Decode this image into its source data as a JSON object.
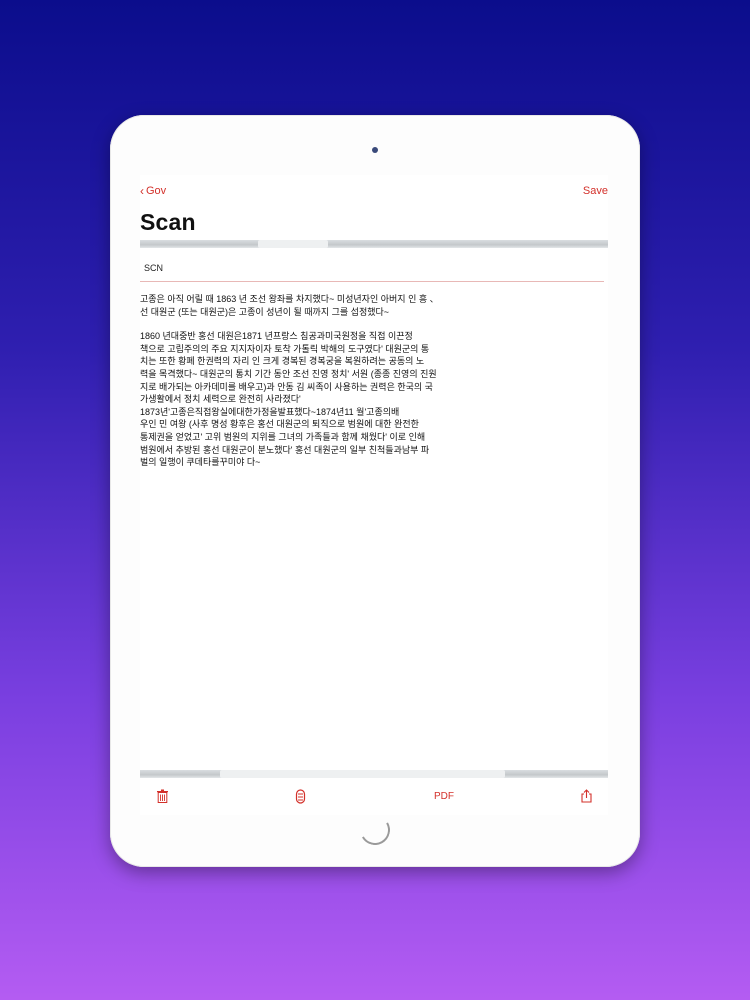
{
  "nav": {
    "back_label": "Gov",
    "save_label": "Save"
  },
  "title": "Scan",
  "field": {
    "value": "SCN"
  },
  "document": {
    "paragraphs": [
      "고종은 아직 어릴 때 1863 년 조선 왕좌를 차지했다~ 미성년자인 아버지 인 흥 、\n선 대원군 (또는 대원군)은 고종이 성년이 될 때까지 그를 섭정했다~",
      "1860 년대중반 홍선 대원은1871 년프랑스 침공과미국원정을 직접 이끈정\n책으로 고립주의의 주요 지지자이자 토착 가톨릭 박해의 도구였다' 대원군의 통\n치는 또한 황폐 한권력의 자리 인 크게 경복된 경복궁을 복원하려는 공동의 노\n력을 목격했다~ 대원군의 통치 기간 동안 조선 진영 정치' 서원 (종종 진영의 진원\n지로 배가되는 아카데미를 배우고)과 안동 김 씨족이 사용하는 권력은 한국의 국\n가생활에서 정치 세력으로 완전히 사라졌다'\n1873년'고종은직접왕실에대한가정을발표했다~1874년11 월'고종의배\n우인 민 여왕 (사후 명성 황후은 홍선 대원군의 퇴직으로 범원에 대한 완전한\n통제권을 얻었고' 고위 범원의 지위를 그녀의 가족들과 함께 채웠다' 이로 인해\n범원에서 추방된 홍선 대원군이 분노했다' 홍선 대원군의 일부 친척들과남부 파\n벌의 일행이 쿠데타를꾸미야 다~"
    ]
  },
  "toolbar": {
    "pdf_label": "PDF"
  },
  "icons": {
    "back": "chevron-left-icon",
    "trash": "trash-icon",
    "scan": "scan-icon",
    "share": "share-icon"
  },
  "colors": {
    "accent": "#d3302a",
    "background_top": "#0b0d8c",
    "background_bottom": "#b45cf2"
  }
}
